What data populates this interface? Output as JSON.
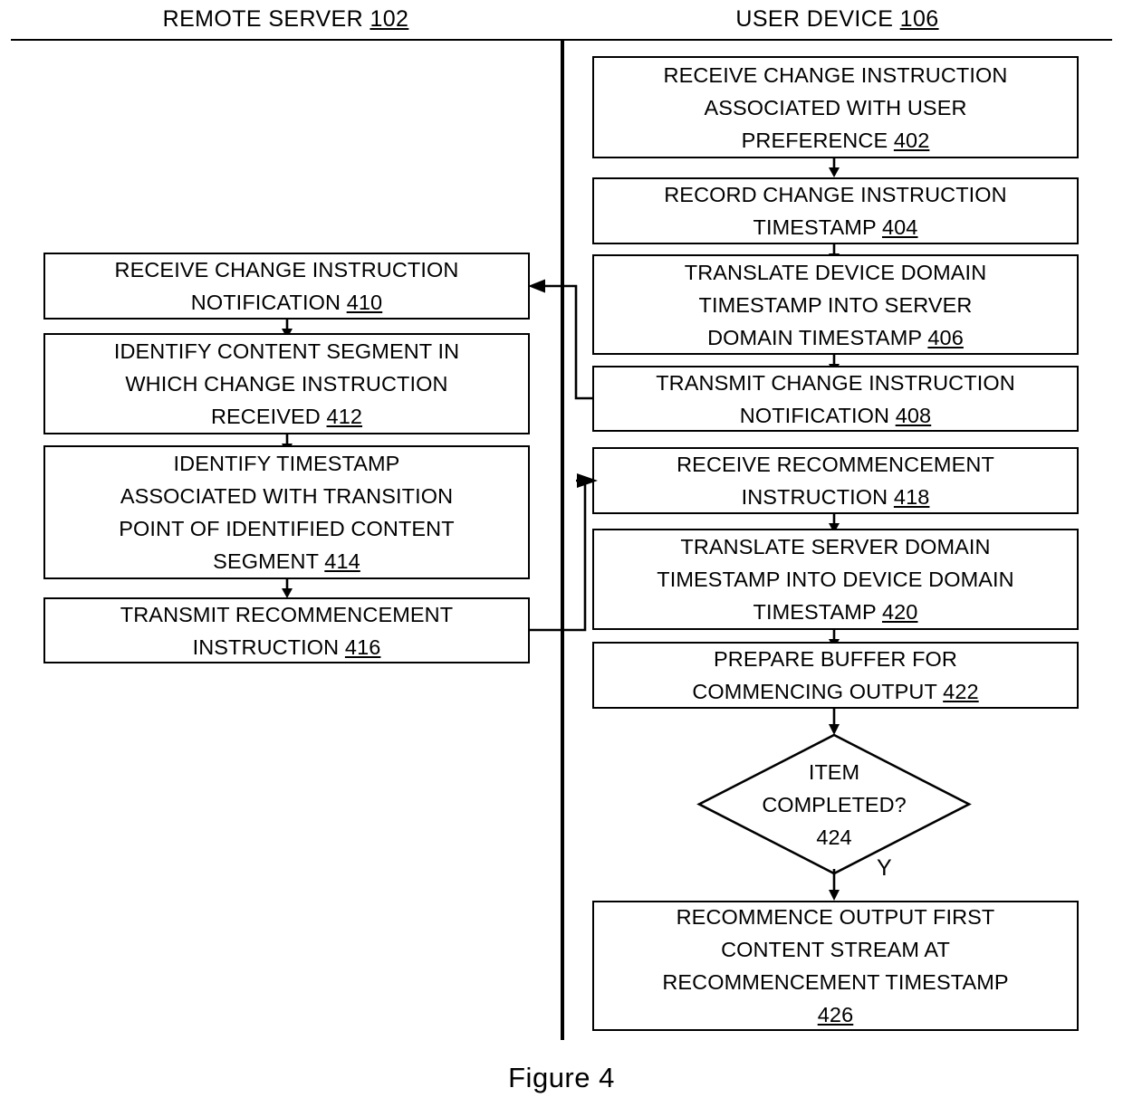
{
  "figure": {
    "caption": "Figure 4"
  },
  "lanes": [
    {
      "id": "remote-server",
      "name": "REMOTE SERVER",
      "ref": "102"
    },
    {
      "id": "user-device",
      "name": "USER DEVICE",
      "ref": "106"
    }
  ],
  "nodes": {
    "n402": {
      "line1": "RECEIVE CHANGE INSTRUCTION",
      "line2": "ASSOCIATED WITH USER",
      "line3": "PREFERENCE",
      "ref": "402"
    },
    "n404": {
      "line1": "RECORD CHANGE INSTRUCTION",
      "line2": "TIMESTAMP",
      "ref": "404"
    },
    "n406": {
      "line1": "TRANSLATE DEVICE DOMAIN",
      "line2": "TIMESTAMP INTO SERVER",
      "line3": "DOMAIN TIMESTAMP",
      "ref": "406"
    },
    "n408": {
      "line1": "TRANSMIT CHANGE INSTRUCTION",
      "line2": "NOTIFICATION",
      "ref": "408"
    },
    "n410": {
      "line1": "RECEIVE CHANGE INSTRUCTION",
      "line2": "NOTIFICATION",
      "ref": "410"
    },
    "n412": {
      "line1": "IDENTIFY CONTENT SEGMENT IN",
      "line2": "WHICH CHANGE INSTRUCTION",
      "line3": "RECEIVED",
      "ref": "412"
    },
    "n414": {
      "line1": "IDENTIFY TIMESTAMP",
      "line2": "ASSOCIATED WITH TRANSITION",
      "line3": "POINT OF IDENTIFIED CONTENT",
      "line4": "SEGMENT",
      "ref": "414"
    },
    "n416": {
      "line1": "TRANSMIT RECOMMENCEMENT",
      "line2": "INSTRUCTION",
      "ref": "416"
    },
    "n418": {
      "line1": "RECEIVE RECOMMENCEMENT",
      "line2": "INSTRUCTION",
      "ref": "418"
    },
    "n420": {
      "line1": "TRANSLATE SERVER DOMAIN",
      "line2": "TIMESTAMP INTO DEVICE DOMAIN",
      "line3": "TIMESTAMP",
      "ref": "420"
    },
    "n422": {
      "line1": "PREPARE BUFFER FOR",
      "line2": "COMMENCING OUTPUT",
      "ref": "422"
    },
    "n424": {
      "line1": "ITEM",
      "line2": "COMPLETED?",
      "ref": "424"
    },
    "n426": {
      "line1": "RECOMMENCE OUTPUT FIRST",
      "line2": "CONTENT STREAM AT",
      "line3": "RECOMMENCEMENT TIMESTAMP",
      "ref": "426"
    }
  },
  "branches": {
    "yes": "Y"
  },
  "colors": {
    "stroke": "#000000",
    "background": "#ffffff"
  }
}
